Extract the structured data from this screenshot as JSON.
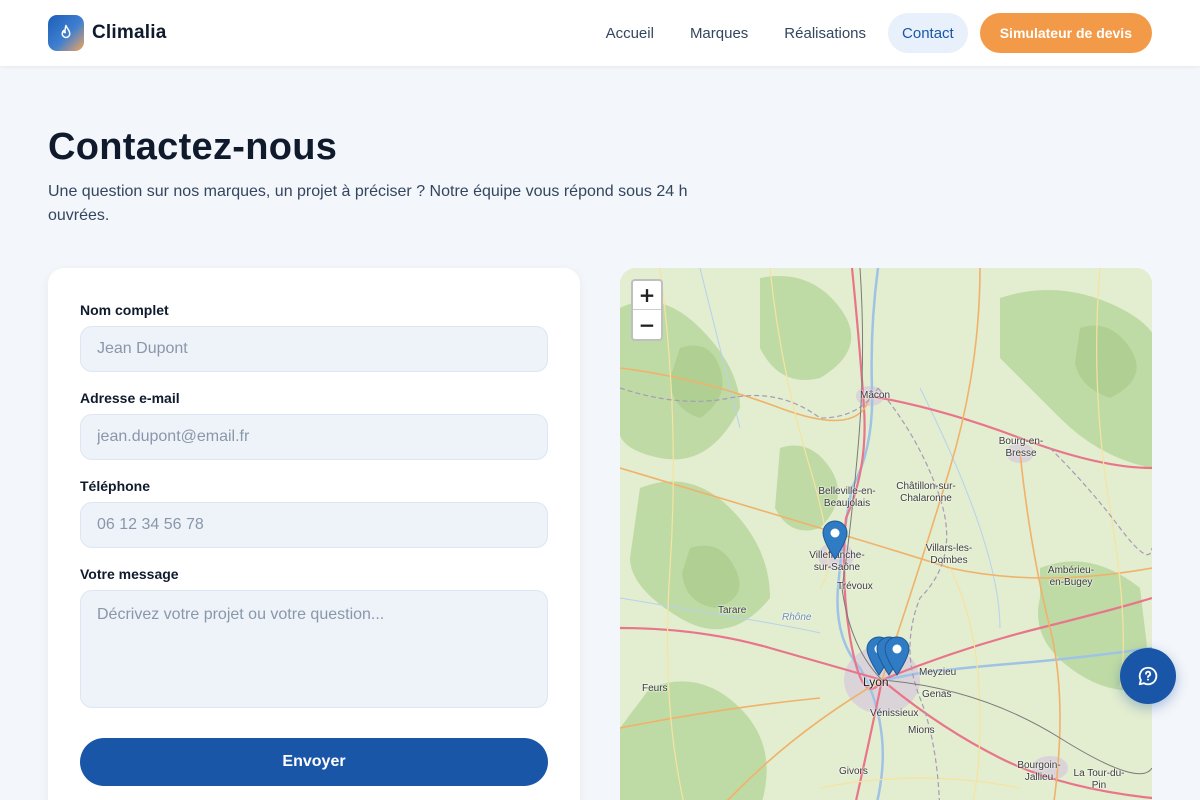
{
  "header": {
    "brand": "Climalia",
    "nav": [
      {
        "label": "Accueil"
      },
      {
        "label": "Marques"
      },
      {
        "label": "Réalisations"
      },
      {
        "label": "Contact",
        "active": true
      }
    ],
    "cta_label": "Simulateur de devis"
  },
  "hero": {
    "title": "Contactez-nous",
    "subtitle": "Une question sur nos marques, un projet à préciser ? Notre équipe vous répond sous 24 h ouvrées."
  },
  "form": {
    "name_label": "Nom complet",
    "name_placeholder": "Jean Dupont",
    "email_label": "Adresse e-mail",
    "email_placeholder": "jean.dupont@email.fr",
    "phone_label": "Téléphone",
    "phone_placeholder": "06 12 34 56 78",
    "message_label": "Votre message",
    "message_placeholder": "Décrivez votre projet ou votre question...",
    "submit_label": "Envoyer"
  },
  "map": {
    "zoom_in": "+",
    "zoom_out": "−",
    "places": [
      {
        "name": "Mâcon"
      },
      {
        "name": "Bourg-en-Bresse"
      },
      {
        "name": "Belleville-en-Beaujolais"
      },
      {
        "name": "Châtillon-sur-Chalaronne"
      },
      {
        "name": "Villefranche-sur-Saône"
      },
      {
        "name": "Villars-les-Dombes"
      },
      {
        "name": "Trévoux"
      },
      {
        "name": "Ambérieu-en-Bugey"
      },
      {
        "name": "Tarare"
      },
      {
        "name": "Rhône"
      },
      {
        "name": "Lyon"
      },
      {
        "name": "Meyzieu"
      },
      {
        "name": "Feurs"
      },
      {
        "name": "Genas"
      },
      {
        "name": "Vénissieux"
      },
      {
        "name": "Mions"
      },
      {
        "name": "Givors"
      },
      {
        "name": "Bourgoin-Jallieu"
      },
      {
        "name": "La Tour-du-Pin"
      }
    ],
    "marker_color": "#2f7bc4"
  },
  "colors": {
    "primary": "#1a56a8",
    "accent": "#f39a48",
    "background": "#f3f6fa"
  }
}
